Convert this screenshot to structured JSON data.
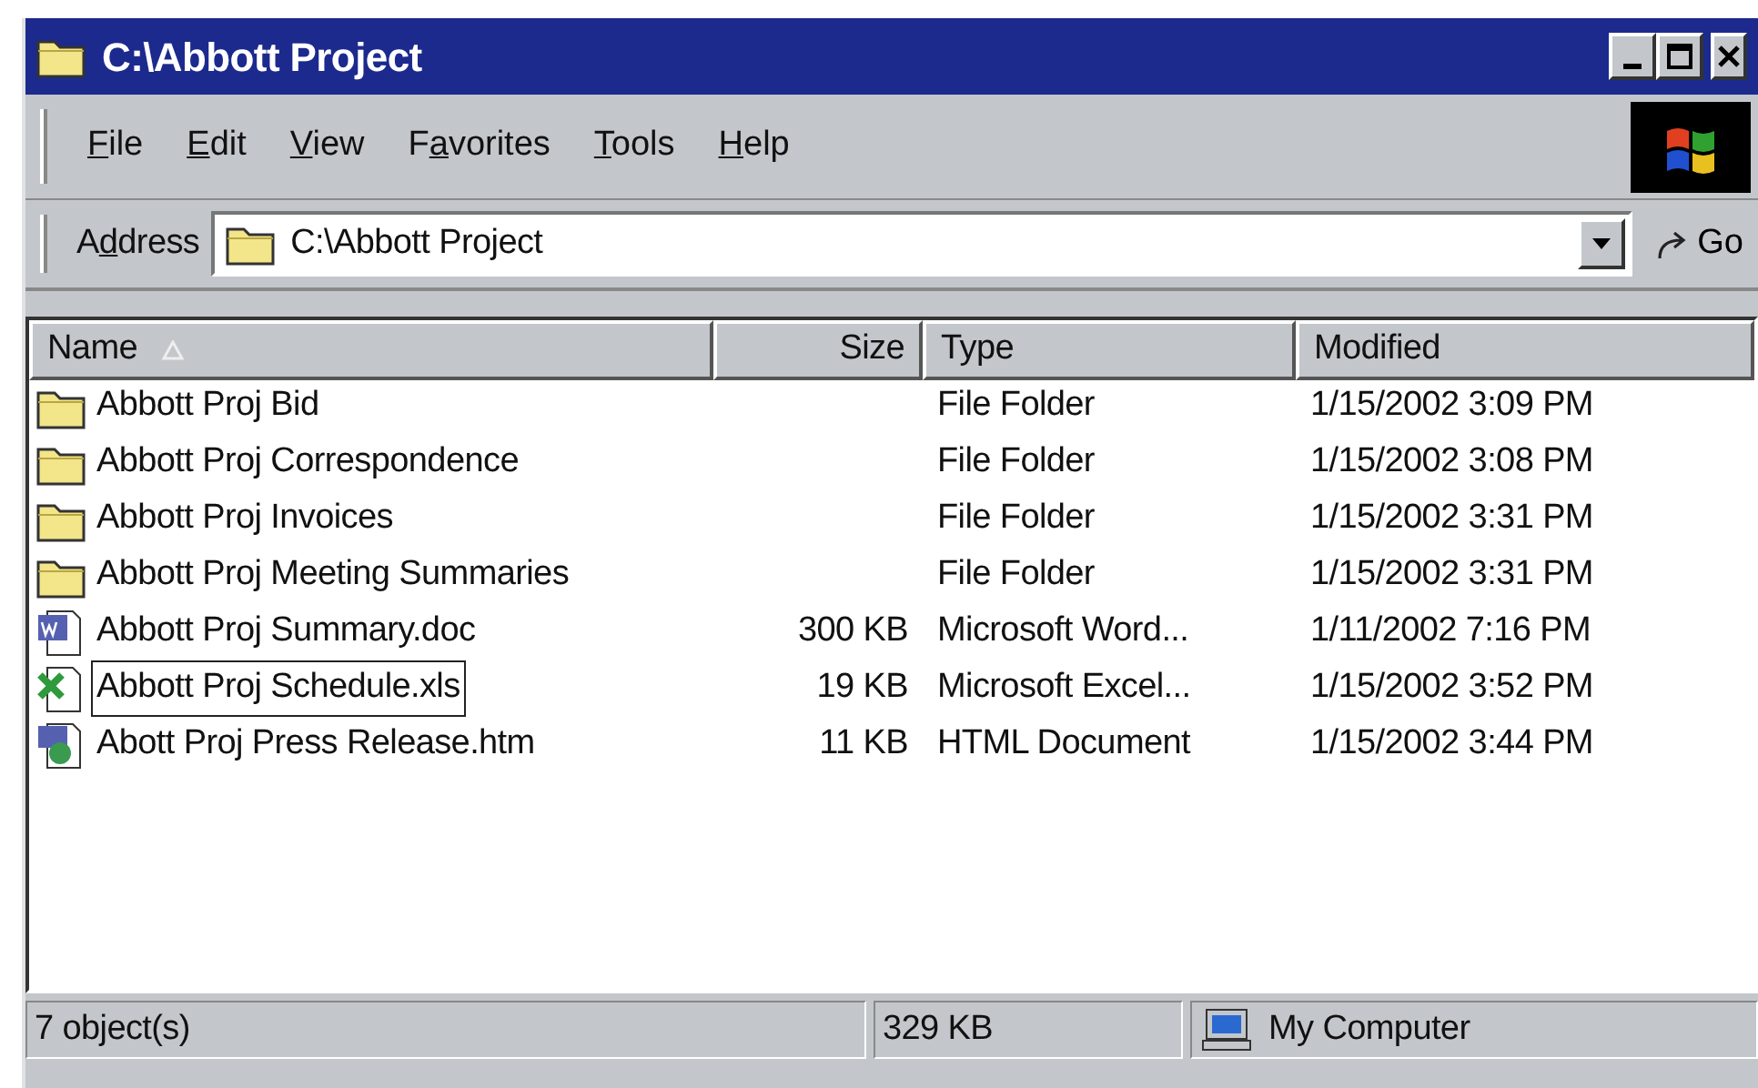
{
  "window": {
    "title": "C:\\Abbott Project"
  },
  "menu": [
    {
      "key": "F",
      "post": "ile"
    },
    {
      "key": "E",
      "post": "dit"
    },
    {
      "key": "V",
      "post": "iew"
    },
    {
      "pre": "F",
      "key": "a",
      "post": "vorites"
    },
    {
      "key": "T",
      "post": "ools"
    },
    {
      "key": "H",
      "post": "elp"
    }
  ],
  "address_bar": {
    "label": {
      "pre": "A",
      "key": "d",
      "post": "dress"
    },
    "value": "C:\\Abbott Project",
    "go": "Go"
  },
  "table": {
    "columns": [
      {
        "label": "Name",
        "sorted": true
      },
      {
        "label": "Size",
        "sorted": false
      },
      {
        "label": "Type",
        "sorted": false
      },
      {
        "label": "Modified",
        "sorted": false
      }
    ],
    "rows": [
      {
        "kind": "folder",
        "name": "Abbott Proj Bid",
        "size": "",
        "type": "File Folder",
        "modified": "1/15/2002 3:09 PM",
        "focused": false
      },
      {
        "kind": "folder",
        "name": "Abbott Proj Correspondence",
        "size": "",
        "type": "File Folder",
        "modified": "1/15/2002 3:08 PM",
        "focused": false
      },
      {
        "kind": "folder",
        "name": "Abbott Proj Invoices",
        "size": "",
        "type": "File Folder",
        "modified": "1/15/2002 3:31 PM",
        "focused": false
      },
      {
        "kind": "folder",
        "name": "Abbott Proj Meeting Summaries",
        "size": "",
        "type": "File Folder",
        "modified": "1/15/2002 3:31 PM",
        "focused": false
      },
      {
        "kind": "word",
        "name": "Abbott Proj Summary.doc",
        "size": "300 KB",
        "type": "Microsoft Word...",
        "modified": "1/11/2002 7:16 PM",
        "focused": false
      },
      {
        "kind": "excel",
        "name": "Abbott Proj Schedule.xls",
        "size": "19 KB",
        "type": "Microsoft Excel...",
        "modified": "1/15/2002 3:52 PM",
        "focused": true
      },
      {
        "kind": "html",
        "name": "Abott Proj Press Release.htm",
        "size": "11 KB",
        "type": "HTML Document",
        "modified": "1/15/2002 3:44 PM",
        "focused": false
      }
    ]
  },
  "status_bar": {
    "objects": "7 object(s)",
    "size": "329 KB",
    "zone": "My Computer"
  }
}
